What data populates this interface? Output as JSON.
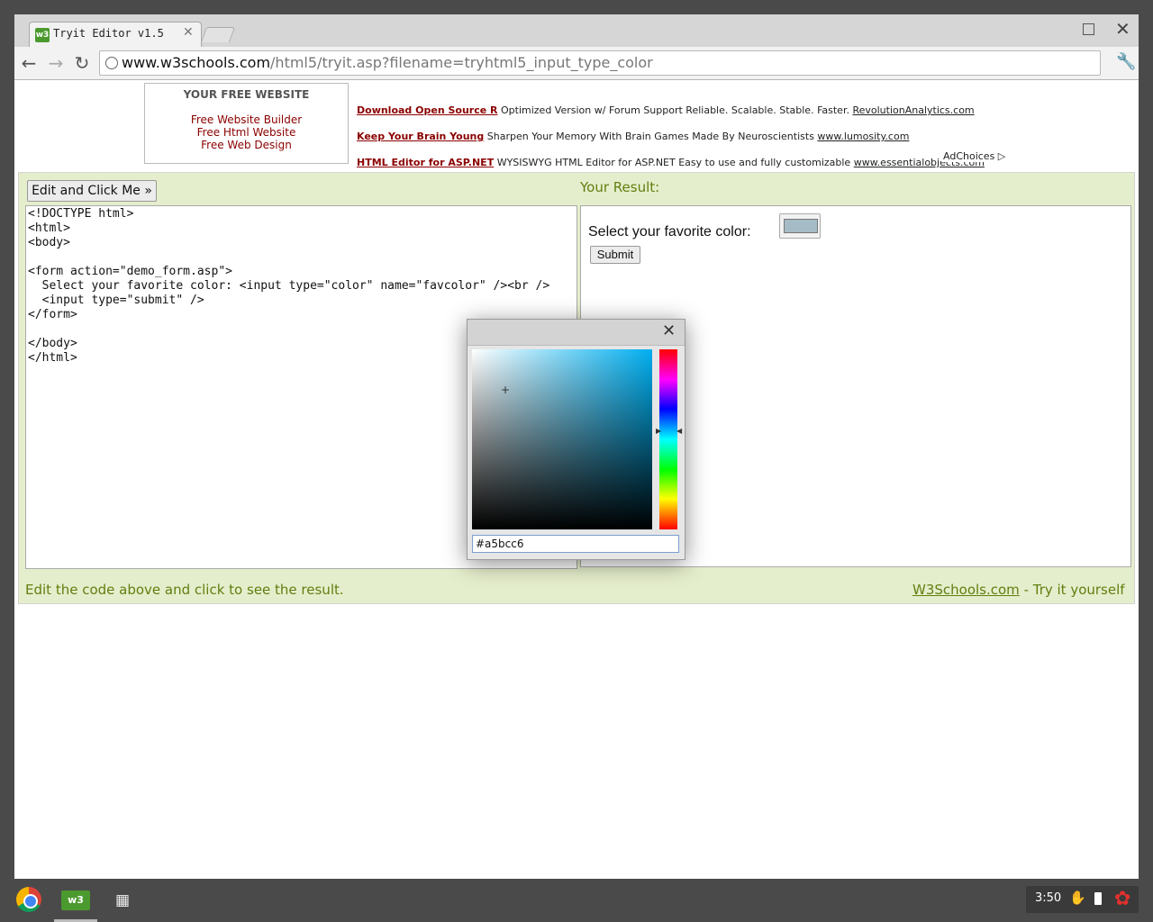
{
  "browser": {
    "tab_title": "Tryit Editor v1.5",
    "tab_favicon": "w3",
    "url_host": "www.w3schools.com",
    "url_path": "/html5/tryit.asp?filename=tryhtml5_input_type_color",
    "icons": [
      "back-icon",
      "forward-icon",
      "reload-icon",
      "star-icon",
      "wrench-icon",
      "close-icon",
      "maximize-icon"
    ]
  },
  "ads": {
    "free_box_title": "YOUR FREE WEBSITE",
    "free_links": [
      "Free Website Builder",
      "Free Html Website",
      "Free Web Design"
    ],
    "lines": [
      {
        "title": "Download Open Source R",
        "text": "Optimized Version w/ Forum Support Reliable. Scalable. Stable. Faster.",
        "url": "RevolutionAnalytics.com"
      },
      {
        "title": "Keep Your Brain Young",
        "text": "Sharpen Your Memory With Brain Games Made By Neuroscientists",
        "url": "www.lumosity.com"
      },
      {
        "title": "HTML Editor for ASP.NET",
        "text": "WYSISWYG HTML Editor for ASP.NET Easy to use and fully customizable",
        "url": "www.essentialobjects.com"
      }
    ],
    "adchoices": "AdChoices ▷"
  },
  "tryit": {
    "edit_button": "Edit and Click Me »",
    "result_label": "Your Result:",
    "code": "<!DOCTYPE html>\n<html>\n<body>\n\n<form action=\"demo_form.asp\">\n  Select your favorite color: <input type=\"color\" name=\"favcolor\" /><br />\n  <input type=\"submit\" />\n</form>\n\n</body>\n</html>",
    "result_text": "Select your favorite color:",
    "submit_label": "Submit",
    "selected_color": "#a5bcc6",
    "footer_left": "Edit the code above and click to see the result.",
    "footer_link": "W3Schools.com",
    "footer_right_suffix": " - Try it yourself"
  },
  "picker": {
    "hex_value": "#a5bcc6",
    "base_hue_color": "#00aff0"
  },
  "shelf": {
    "clock": "3:50",
    "icons": [
      "chrome-icon",
      "w3schools-app-icon",
      "apps-grid-icon",
      "hand-icon",
      "battery-icon",
      "user-avatar-icon"
    ]
  }
}
